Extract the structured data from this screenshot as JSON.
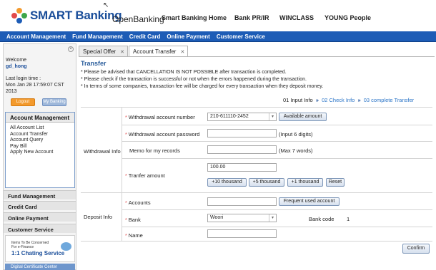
{
  "header": {
    "brand": "SMART Banking",
    "openbanking": "OpenBanking",
    "nav": [
      "Smart Banking Home",
      "Bank PR/IR",
      "WINCLASS",
      "YOUNG People"
    ],
    "brand_color": "#1a4e9a"
  },
  "menubar": {
    "items": [
      "Account Management",
      "Fund Management",
      "Credit Card",
      "Online Payment",
      "Customer Service"
    ],
    "bg_color": "#1d5cb6"
  },
  "sidebar": {
    "welcome": "Welcome",
    "username": "gd_hong",
    "last_login_label": "Last login time :",
    "last_login_value": "Mon Jan 28 17:59:07 CST 2013",
    "logout_label": "Logout",
    "mybanking_label": "My Banking",
    "section_title": "Account Management",
    "links": [
      "All Account List",
      "Account Transfer",
      "Account Query",
      "Pay Bill",
      "Apply New Account"
    ],
    "menus": [
      "Fund Management",
      "Credit Card",
      "Online Payment",
      "Customer Service"
    ],
    "promo_small": "Items To Be Concerned For e-Finance",
    "promo_big": "1:1 Chating Service",
    "cert_label": "Digital Certificate Center"
  },
  "tabs": [
    {
      "label": "Special Offer",
      "close": "✕"
    },
    {
      "label": "Account Transfer",
      "close": "✕"
    }
  ],
  "content": {
    "title": "Transfer",
    "notices": [
      "* Please be advised that CANCELLATION IS NOT POSSIBLE after transaction is completed.",
      "* Please check if the transaction is successful or not when the errors happened during the transaction.",
      "* In terms of some companies, transaction fee will be charged for every transaction when they deposit money."
    ],
    "steps": {
      "s1": "01 Input Info",
      "s2": "02 Check Info",
      "s3": "03 complete Transfer",
      "arrow": "»"
    },
    "withdrawal": {
      "section_label": "Withdrawal Info",
      "account_number_label": "Withdrawal account number",
      "account_number_value": "210-611110-2452",
      "available_amount_button": "Available amount",
      "password_label": "Withdrawal account password",
      "password_hint": "(Input 6 digits)",
      "memo_label": "Memo for my records",
      "memo_hint": "(Max 7 words)",
      "amount_label": "Tranfer amount",
      "amount_value": "100.00",
      "quick_buttons": [
        "+10 thousand",
        "+5 thousand",
        "+1 thousand",
        "Reset"
      ]
    },
    "deposit": {
      "section_label": "Deposit Info",
      "accounts_label": "Accounts",
      "frequent_button": "Frequent used account",
      "bank_label": "Bank",
      "bank_value": "Woori",
      "bank_code_label": "Bank code",
      "bank_code_value": "1",
      "name_label": "Name"
    },
    "required_mark": "*",
    "confirm_button": "Confirm"
  }
}
